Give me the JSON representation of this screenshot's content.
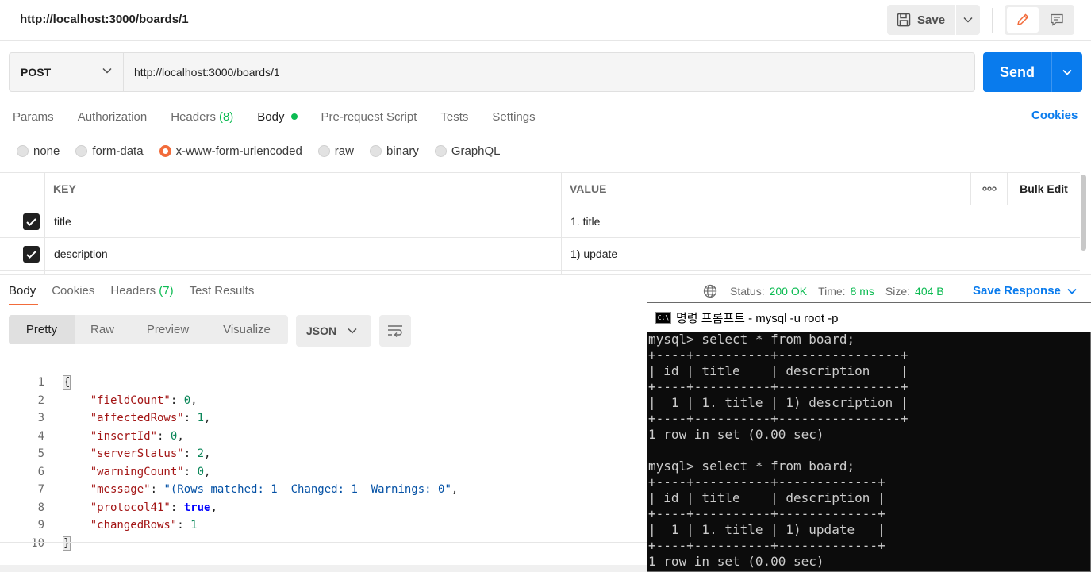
{
  "topbar": {
    "title": "http://localhost:3000/boards/1",
    "save_label": "Save"
  },
  "request": {
    "method": "POST",
    "url": "http://localhost:3000/boards/1",
    "send_label": "Send"
  },
  "req_tabs": [
    {
      "label": "Params",
      "count": ""
    },
    {
      "label": "Authorization",
      "count": ""
    },
    {
      "label": "Headers",
      "count": "(8)"
    },
    {
      "label": "Body",
      "count": ""
    },
    {
      "label": "Pre-request Script",
      "count": ""
    },
    {
      "label": "Tests",
      "count": ""
    },
    {
      "label": "Settings",
      "count": ""
    }
  ],
  "cookies_label": "Cookies",
  "body_types": [
    "none",
    "form-data",
    "x-www-form-urlencoded",
    "raw",
    "binary",
    "GraphQL"
  ],
  "body_type_selected": "x-www-form-urlencoded",
  "kv": {
    "key_header": "KEY",
    "value_header": "VALUE",
    "more": "ooo",
    "bulk_edit": "Bulk Edit",
    "rows": [
      {
        "key": "title",
        "value": "1. title",
        "checked": true
      },
      {
        "key": "description",
        "value": "1) update",
        "checked": true
      }
    ]
  },
  "response": {
    "tabs": [
      {
        "label": "Body",
        "count": ""
      },
      {
        "label": "Cookies",
        "count": ""
      },
      {
        "label": "Headers",
        "count": "(7)"
      },
      {
        "label": "Test Results",
        "count": ""
      }
    ],
    "status_label": "Status:",
    "status_value": "200 OK",
    "time_label": "Time:",
    "time_value": "8 ms",
    "size_label": "Size:",
    "size_value": "404 B",
    "save_response": "Save Response",
    "view_tabs": [
      "Pretty",
      "Raw",
      "Preview",
      "Visualize"
    ],
    "format": "JSON"
  },
  "code_lines": [
    {
      "n": "1",
      "key": "",
      "val": ""
    },
    {
      "n": "2",
      "key": "\"fieldCount\"",
      "val": "0"
    },
    {
      "n": "3",
      "key": "\"affectedRows\"",
      "val": "1"
    },
    {
      "n": "4",
      "key": "\"insertId\"",
      "val": "0"
    },
    {
      "n": "5",
      "key": "\"serverStatus\"",
      "val": "2"
    },
    {
      "n": "6",
      "key": "\"warningCount\"",
      "val": "0"
    },
    {
      "n": "7",
      "key": "\"message\"",
      "val": "\"(Rows matched: 1  Changed: 1  Warnings: 0\""
    },
    {
      "n": "8",
      "key": "\"protocol41\"",
      "val": "true"
    },
    {
      "n": "9",
      "key": "\"changedRows\"",
      "val": "1"
    },
    {
      "n": "10",
      "key": "",
      "val": ""
    }
  ],
  "cmd": {
    "title": "명령 프롬프트 - mysql  -u root -p",
    "lines": [
      "mysql> select * from board;",
      "+----+----------+----------------+",
      "| id | title    | description    |",
      "+----+----------+----------------+",
      "|  1 | 1. title | 1) description |",
      "+----+----------+----------------+",
      "1 row in set (0.00 sec)",
      "",
      "mysql> select * from board;",
      "+----+----------+-------------+",
      "| id | title    | description |",
      "+----+----------+-------------+",
      "|  1 | 1. title | 1) update   |",
      "+----+----------+-------------+",
      "1 row in set (0.00 sec)"
    ]
  }
}
